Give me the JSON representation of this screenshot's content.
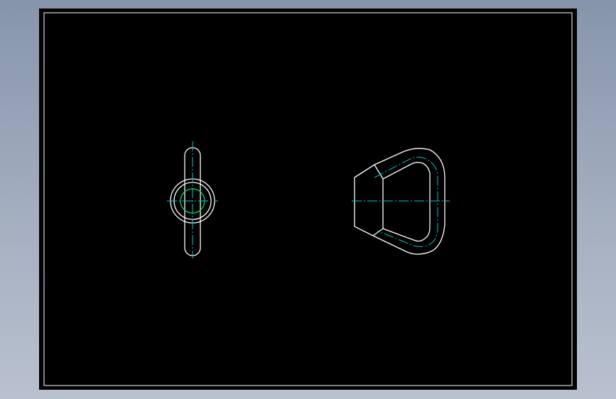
{
  "colors": {
    "background": "#8f9cb1",
    "sheet": "#000000",
    "outline": "#ffffff",
    "centerline": "#00c8c8",
    "hidden_circle": "#00e070"
  },
  "views": [
    {
      "name": "side-view",
      "description_shape": "link bar with boss"
    },
    {
      "name": "front-view",
      "description_shape": "triangular ring"
    }
  ]
}
